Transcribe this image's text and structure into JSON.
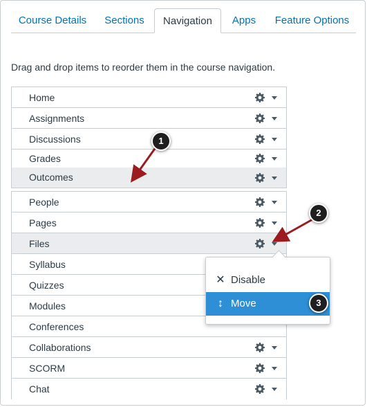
{
  "tabs": [
    {
      "label": "Course Details"
    },
    {
      "label": "Sections"
    },
    {
      "label": "Navigation",
      "active": true
    },
    {
      "label": "Apps"
    },
    {
      "label": "Feature Options"
    }
  ],
  "instructions": "Drag and drop items to reorder them in the course navigation.",
  "enabled_items": [
    {
      "label": "Home"
    },
    {
      "label": "Assignments"
    },
    {
      "label": "Discussions"
    },
    {
      "label": "Grades"
    },
    {
      "label": "Outcomes"
    }
  ],
  "hidden_items": [
    {
      "label": "People"
    },
    {
      "label": "Pages"
    },
    {
      "label": "Files"
    },
    {
      "label": "Syllabus"
    },
    {
      "label": "Quizzes"
    },
    {
      "label": "Modules"
    },
    {
      "label": "Conferences"
    },
    {
      "label": "Collaborations"
    },
    {
      "label": "SCORM"
    },
    {
      "label": "Chat"
    }
  ],
  "popup_menu": {
    "disable_label": "Disable",
    "disable_icon": "close-x-icon",
    "move_label": "Move",
    "move_icon": "vertical-arrows-icon"
  },
  "callouts": [
    "1",
    "2",
    "3"
  ],
  "colors": {
    "link": "#0073b8",
    "text": "#2d3b45",
    "border": "#c7cdd1",
    "shaded_row": "#eaecee",
    "menu_highlight": "#2e8fd6",
    "arrow": "#9b1b1f"
  }
}
